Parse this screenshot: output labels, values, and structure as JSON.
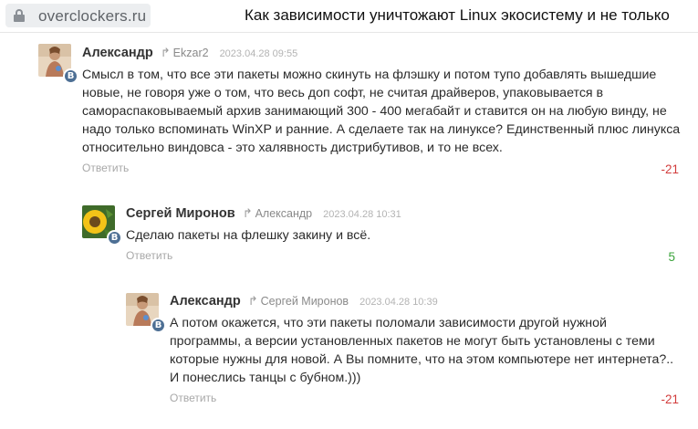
{
  "browser": {
    "url": "overclockers.ru",
    "page_title": "Как зависимости уничтожают Linux экосистему и не только"
  },
  "colors": {
    "negative": "#d23c3c",
    "positive": "#3aa33a",
    "vk_badge": "#4d6f94"
  },
  "comments": [
    {
      "author": "Александр",
      "reply_to": "Ekzar2",
      "timestamp": "2023.04.28 09:55",
      "badge": "В",
      "text": "Смысл в том, что все эти пакеты можно скинуть на флэшку и потом тупо добавлять вышедшие новые, не говоря уже о том, что весь доп софт, не считая драйверов, упаковывается в самораспаковываемый архив занимающий 300 - 400 мегабайт и ставится он на любую винду, не надо только вспоминать WinXP и ранние. А сделаете так на линуксе? Единственный плюс линукса относительно виндовса - это халявность дистрибутивов, и то не всех.",
      "reply_label": "Ответить",
      "rating": "-21"
    },
    {
      "author": "Сергей Миронов",
      "reply_to": "Александр",
      "timestamp": "2023.04.28 10:31",
      "badge": "В",
      "text": "Сделаю пакеты на флешку закину и всё.",
      "reply_label": "Ответить",
      "rating": "5"
    },
    {
      "author": "Александр",
      "reply_to": "Сергей Миронов",
      "timestamp": "2023.04.28 10:39",
      "badge": "В",
      "text": "А потом окажется, что эти пакеты поломали зависимости другой нужной программы, а версии установленных пакетов не могут быть установлены с теми которые нужны для новой. А Вы помните, что на этом компьютере нет интернета?.. И понеслись танцы с бубном.)))",
      "reply_label": "Ответить",
      "rating": "-21"
    }
  ]
}
